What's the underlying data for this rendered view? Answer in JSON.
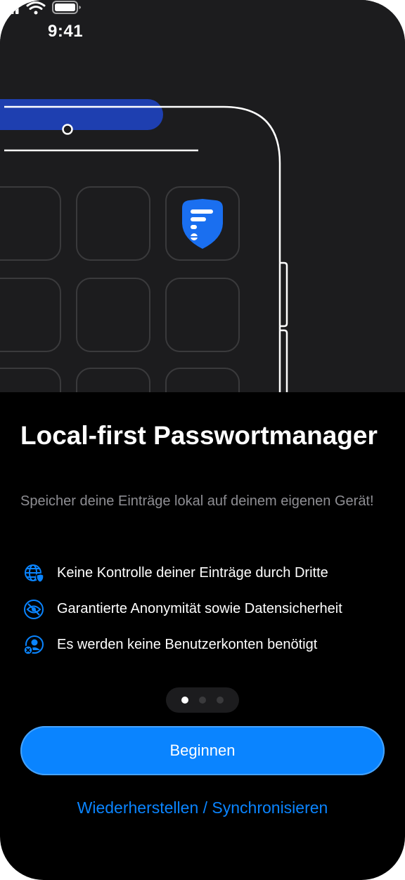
{
  "status_bar": {
    "time": "9:41",
    "icons": [
      "signal-icon",
      "wifi-icon",
      "battery-icon"
    ]
  },
  "onboarding": {
    "title": "Local-first Passwortmanager",
    "subtitle": "Speicher deine Einträge lokal auf deinem eigenen Gerät!",
    "features": [
      {
        "icon": "globe-shield-icon",
        "text": "Keine Kontrolle deiner Einträge durch Dritte"
      },
      {
        "icon": "eye-slash-icon",
        "text": "Garantierte Anonymität sowie Datensicherheit"
      },
      {
        "icon": "no-account-icon",
        "text": "Es werden keine Benutzerkonten benötigt"
      }
    ],
    "page_indicator": {
      "total": 3,
      "current": 1
    },
    "primary_button": "Beginnen",
    "secondary_link": "Wiederherstellen / Synchronisieren"
  },
  "colors": {
    "background": "#000000",
    "hero_background": "#1c1c1e",
    "accent": "#0a84ff",
    "pill_blue": "#1e3fb0",
    "secondary_text": "#8e8e93"
  }
}
